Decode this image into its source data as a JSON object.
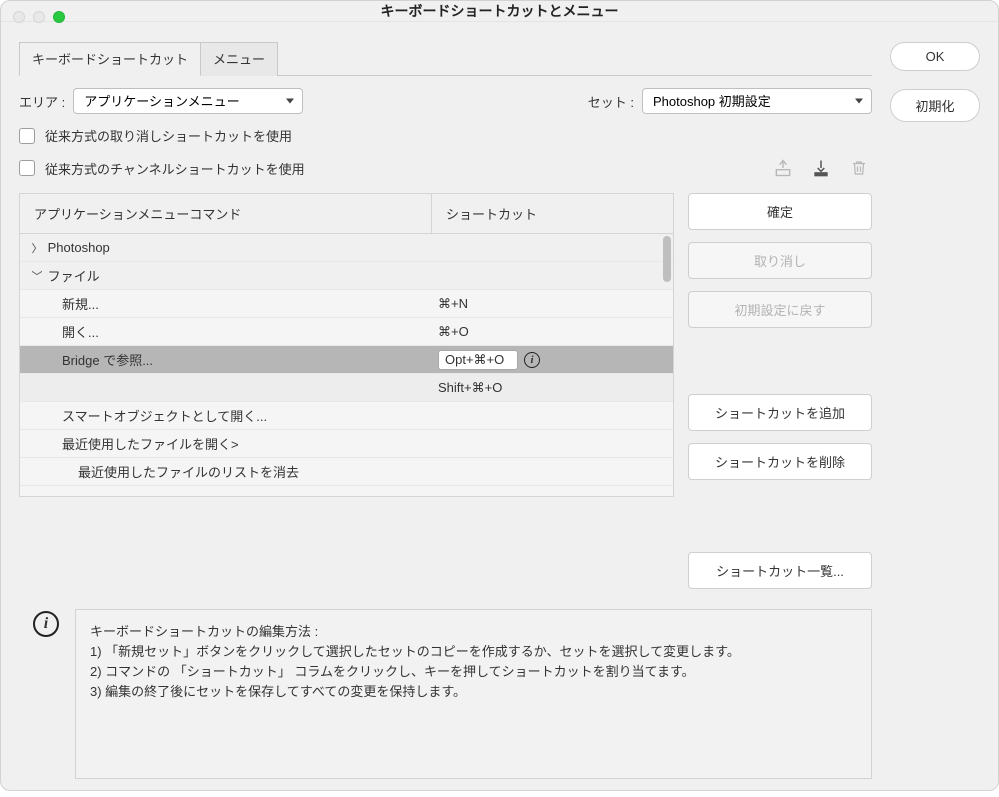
{
  "window": {
    "title": "キーボードショートカットとメニュー"
  },
  "tabs": {
    "shortcuts": "キーボードショートカット",
    "menus": "メニュー"
  },
  "area": {
    "label": "エリア :",
    "value": "アプリケーションメニュー"
  },
  "set": {
    "label": "セット :",
    "value": "Photoshop 初期設定"
  },
  "checks": {
    "legacy_undo": "従来方式の取り消しショートカットを使用",
    "legacy_channel": "従来方式のチャンネルショートカットを使用"
  },
  "toolbar_icons": {
    "save_as": "save-set-as-icon",
    "save": "save-set-icon",
    "delete": "delete-set-icon"
  },
  "columns": {
    "command": "アプリケーションメニューコマンド",
    "shortcut": "ショートカット"
  },
  "tree": [
    {
      "type": "group",
      "expanded": false,
      "label": "Photoshop"
    },
    {
      "type": "group",
      "expanded": true,
      "label": "ファイル"
    },
    {
      "type": "item",
      "label": "新規...",
      "shortcut": "⌘+N"
    },
    {
      "type": "item",
      "label": "開く...",
      "shortcut": "⌘+O"
    },
    {
      "type": "item",
      "label": "Bridge で参照...",
      "shortcut": "Opt+⌘+O",
      "selected": true,
      "editing": true
    },
    {
      "type": "extra",
      "shortcut": "Shift+⌘+O"
    },
    {
      "type": "item",
      "label": "スマートオブジェクトとして開く...",
      "shortcut": ""
    },
    {
      "type": "item",
      "label": "最近使用したファイルを開く>",
      "shortcut": ""
    },
    {
      "type": "subitem",
      "label": "最近使用したファイルのリストを消去",
      "shortcut": ""
    }
  ],
  "side_buttons": {
    "accept": "確定",
    "undo": "取り消し",
    "use_default": "初期設定に戻す",
    "add": "ショートカットを追加",
    "delete": "ショートカットを削除",
    "summarize": "ショートカット一覧..."
  },
  "right_buttons": {
    "ok": "OK",
    "reset": "初期化"
  },
  "info": {
    "heading": "キーボードショートカットの編集方法 :",
    "line1": "1) 「新規セット」ボタンをクリックして選択したセットのコピーを作成するか、セットを選択して変更します。",
    "line2": "2) コマンドの 「ショートカット」 コラムをクリックし、キーを押してショートカットを割り当てます。",
    "line3": "3) 編集の終了後にセットを保存してすべての変更を保持します。"
  }
}
